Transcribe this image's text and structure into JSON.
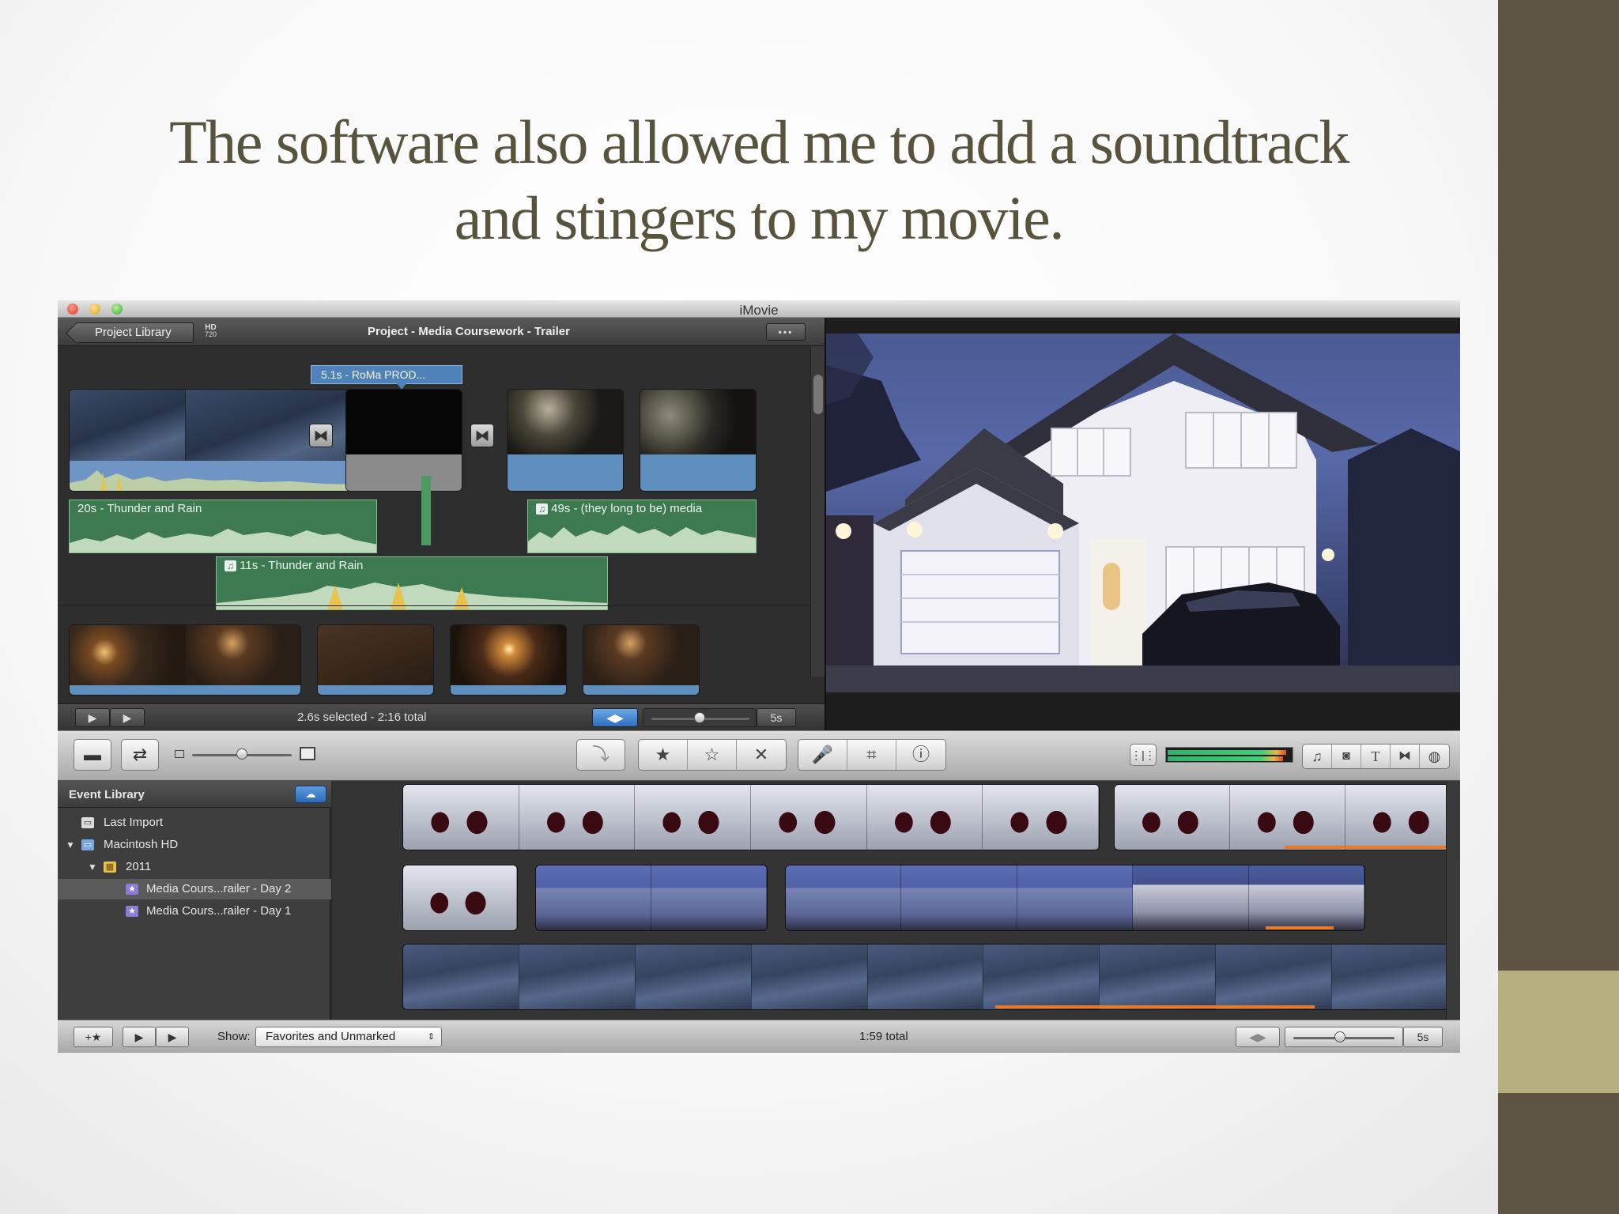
{
  "slide": {
    "title_line1": "The software also allowed me to add a soundtrack",
    "title_line2": "and stingers to my movie."
  },
  "window": {
    "title": "iMovie"
  },
  "project": {
    "back_label": "Project Library",
    "hd_badge_top": "HD",
    "hd_badge_bottom": "720",
    "title": "Project - Media Coursework - Trailer",
    "title_clip_label": "5.1s - RoMa PROD...",
    "music_tracks": [
      {
        "label": "20s - Thunder and Rain"
      },
      {
        "label": "49s - (they long to be) media"
      },
      {
        "label": "11s - Thunder and Rain"
      }
    ],
    "status": "2.6s selected - 2:16 total",
    "zoom_label": "5s"
  },
  "event_library": {
    "header": "Event Library",
    "items": [
      {
        "label": "Last Import",
        "icon": "film-roll-icon"
      },
      {
        "label": "Macintosh HD",
        "icon": "hard-drive-icon"
      },
      {
        "label": "2011",
        "icon": "calendar-icon"
      },
      {
        "label": "Media Cours...railer - Day 2",
        "icon": "event-star-icon",
        "selected": true
      },
      {
        "label": "Media Cours...railer - Day 1",
        "icon": "event-star-icon"
      }
    ]
  },
  "footer": {
    "show_label": "Show:",
    "show_value": "Favorites and Unmarked",
    "total": "1:59 total",
    "zoom_label": "5s"
  },
  "colors": {
    "slide_title": "#58533c",
    "band_dark": "#5d5542",
    "band_light": "#b5af7f",
    "audio_clip": "#3d7a52",
    "title_clip": "#4f82b8",
    "orange_marker": "#ea7a2a"
  }
}
